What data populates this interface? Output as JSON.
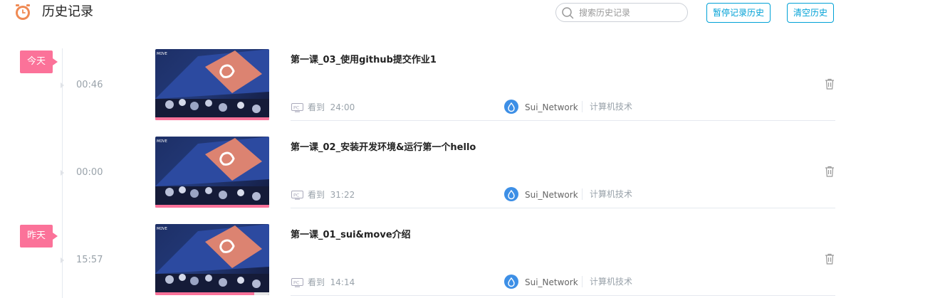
{
  "header": {
    "icon": "clock-icon",
    "title": "历史记录",
    "search_placeholder": "搜索历史记录",
    "pause_label": "暂停记录历史",
    "clear_label": "清空历史"
  },
  "timeline": {
    "day_tags": [
      "今天",
      "昨天"
    ]
  },
  "items": [
    {
      "time": "00:46",
      "title": "第一课_03_使用github提交作业1",
      "device_icon": "pc-icon",
      "watched_label": "看到",
      "watched_time": "24:00",
      "author": "Sui_Network",
      "category": "计算机技术",
      "progress": 1.0
    },
    {
      "time": "00:00",
      "title": "第一课_02_安装开发环境&运行第一个hello",
      "device_icon": "pc-icon",
      "watched_label": "看到",
      "watched_time": "31:22",
      "author": "Sui_Network",
      "category": "计算机技术",
      "progress": 1.0
    },
    {
      "time": "15:57",
      "title": "第一课_01_sui&move介绍",
      "device_icon": "pc-icon",
      "watched_label": "看到",
      "watched_time": "14:14",
      "author": "Sui_Network",
      "category": "计算机技术",
      "progress": 0.87
    }
  ],
  "colors": {
    "accent_pink": "#fb7299",
    "accent_blue": "#00a1d6",
    "avatar_blue": "#3d8fe6"
  }
}
